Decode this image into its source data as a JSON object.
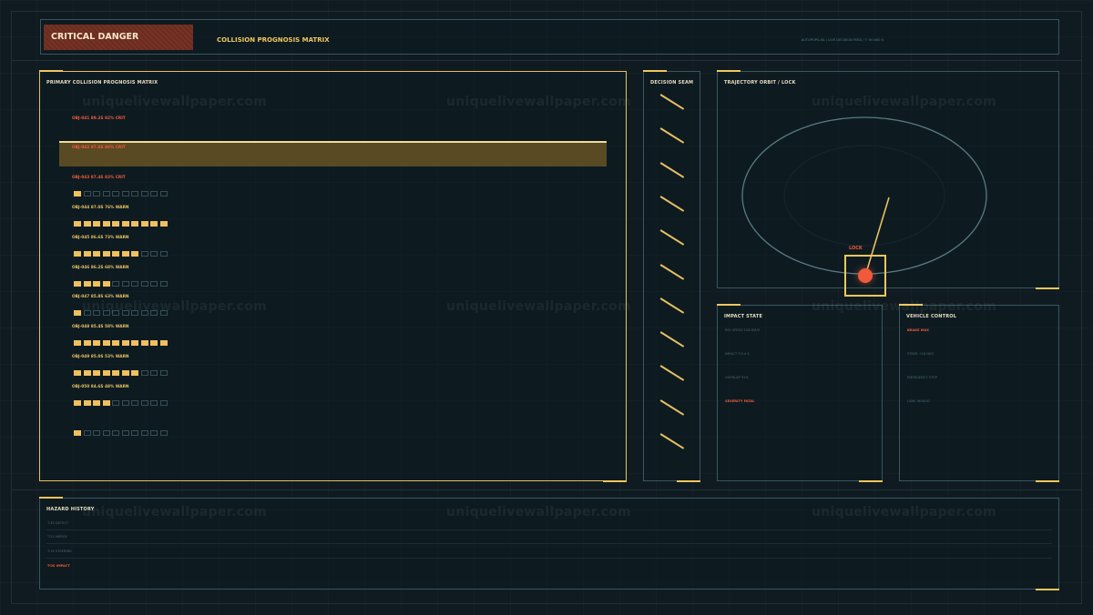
{
  "header": {
    "alert": "CRITICAL DANGER",
    "title": "COLLISION PROGNOSIS MATRIX",
    "status": "AUTOPOPS-XIL  /  LIVE DECISION FEED  /  T: 00:000 S"
  },
  "matrix": {
    "title": "PRIMARY COLLISION PROGNOSIS MATRIX",
    "rows": [
      {
        "label": "OBJ-041  89.2S  92%  CRIT",
        "level": "crit",
        "filled": null
      },
      {
        "label": "OBJ-042  87.8S  88%  CRIT",
        "level": "crit",
        "filled": null
      },
      {
        "label": "OBJ-043  87.4S  83%  CRIT",
        "level": "crit",
        "filled": 1
      },
      {
        "label": "OBJ-044  87.0S  76%  WARN",
        "level": "warn",
        "filled": 10
      },
      {
        "label": "OBJ-045  86.6S  73%  WARN",
        "level": "warn",
        "filled": 7
      },
      {
        "label": "OBJ-046  86.2S  68%  WARN",
        "level": "warn",
        "filled": 4
      },
      {
        "label": "OBJ-047  85.8S  63%  WARN",
        "level": "warn",
        "filled": 1
      },
      {
        "label": "OBJ-048  85.4S  58%  WARN",
        "level": "warn",
        "filled": 10
      },
      {
        "label": "OBJ-049  85.0S  53%  WARN",
        "level": "warn",
        "filled": 7
      },
      {
        "label": "OBJ-050  84.6S  48%  WARN",
        "level": "warn",
        "filled": 4
      },
      {
        "label": "",
        "level": "warn",
        "filled": 1
      }
    ]
  },
  "seam": {
    "title": "DECISION SEAM"
  },
  "orbit": {
    "title": "TRAJECTORY ORBIT / LOCK",
    "lock_label": "LOCK"
  },
  "impact": {
    "title": "IMPACT STATE",
    "items": [
      {
        "text": "REL SPEED 128 KM/H",
        "alert": false
      },
      {
        "text": "IMPACT T-0.4 S",
        "alert": false
      },
      {
        "text": "OVERLAP 91%",
        "alert": false
      },
      {
        "text": "SEVERITY FATAL",
        "alert": true
      }
    ]
  },
  "vehicle": {
    "title": "VEHICLE CONTROL",
    "items": [
      {
        "text": "BRAKE MAX",
        "alert": true
      },
      {
        "text": "STEER +18 DEG",
        "alert": false
      },
      {
        "text": "EMERGENCY STOP",
        "alert": false
      },
      {
        "text": "LANE INVALID",
        "alert": false
      }
    ]
  },
  "history": {
    "title": "HAZARD HISTORY",
    "items": [
      {
        "text": "T-3S DETECT",
        "alert": false
      },
      {
        "text": "T-2S MERGE",
        "alert": false
      },
      {
        "text": "T-1S STEERING",
        "alert": false
      },
      {
        "text": "T-0S IMPACT",
        "alert": true
      }
    ]
  },
  "watermark": "uniquelivewallpaper.com",
  "colors": {
    "accent": "#f0c75e",
    "danger": "#f05a3a",
    "panel_border": "#3a5560",
    "background": "#0f1b21"
  }
}
